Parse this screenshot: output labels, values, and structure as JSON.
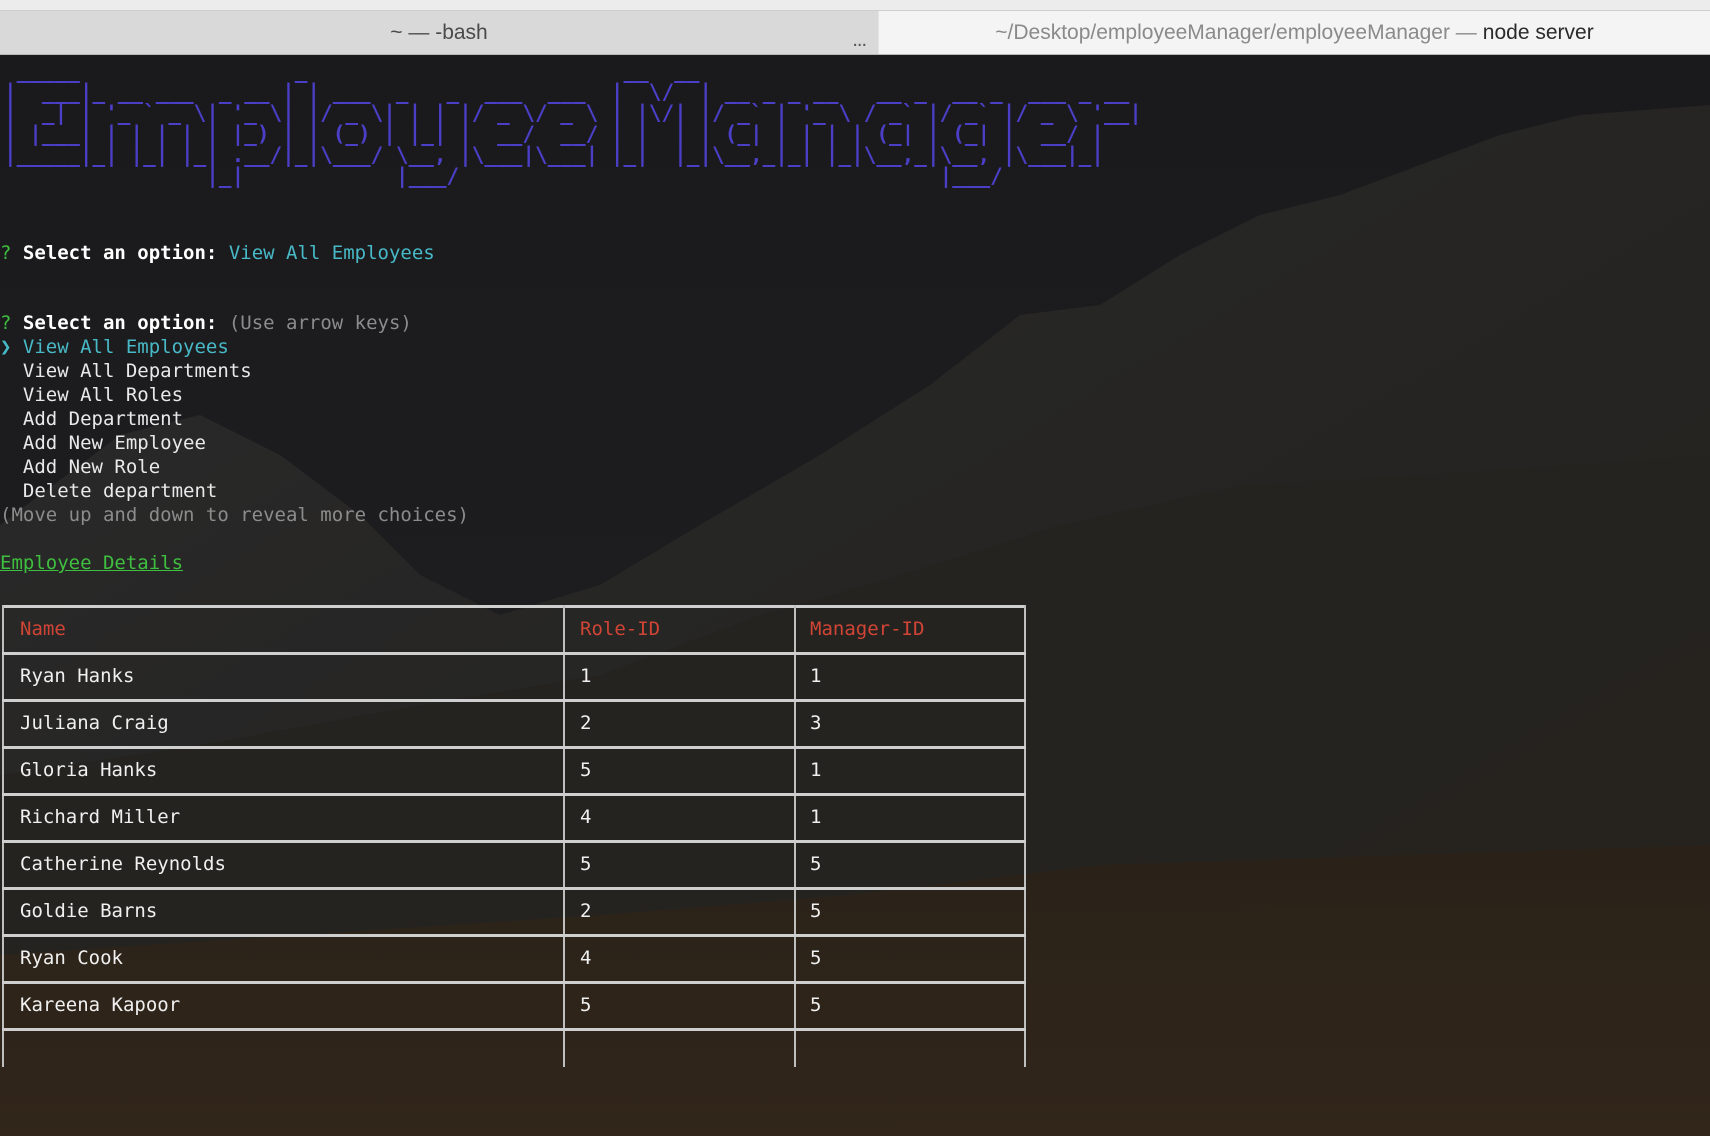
{
  "tabs": [
    {
      "label": "~ — -bash",
      "menu_glyph": "..."
    },
    {
      "label_path": "~/Desktop/employeeManager/employeeManager —",
      "label_process": "node server"
    }
  ],
  "banner": " _____                 _                         __  __\n|  ___|_ __ ___  _ __ | | ___  _   _  ___  ___  |  \\/  | __ _ _ __   __ _  __ _  ___ _ __\n|  _| | '_ ` _ \\| '_ \\| |/ _ \\| | | |/ _ \\/ _ \\ | |\\/| |/ _` | '_ \\ / _` |/ _` |/ _ \\ '__|\n| |___| | | | | | |_) | | (_) | |_| |  __/  __/ | |  | | (_| | | | | (_| | (_| |  __/ |\n|_____|_| |_| |_| .__/|_|\\___/ \\__, |\\___|\\___| |_|  |_|\\__,_|_| |_|\\__,_|\\__, |\\___|_|\n                |_|            |___/                                      |___/",
  "prompt1": {
    "mark": "?",
    "label": "Select an option:",
    "answer": "View All Employees"
  },
  "prompt2": {
    "mark": "?",
    "label": "Select an option:",
    "hint": "(Use arrow keys)"
  },
  "menu": {
    "pointer": "❯",
    "items": [
      "View All Employees",
      "View All Departments",
      "View All Roles",
      "Add Department",
      "Add New Employee",
      "Add New Role",
      "Delete department"
    ],
    "footer": "(Move up and down to reveal more choices)"
  },
  "section_title": "Employee Details",
  "table": {
    "headers": [
      "Name",
      "Role-ID",
      "Manager-ID"
    ],
    "rows": [
      [
        "Ryan Hanks",
        "1",
        "1"
      ],
      [
        "Juliana Craig",
        "2",
        "3"
      ],
      [
        "Gloria Hanks",
        "5",
        "1"
      ],
      [
        "Richard Miller",
        "4",
        "1"
      ],
      [
        "Catherine Reynolds",
        "5",
        "5"
      ],
      [
        "Goldie Barns",
        "2",
        "5"
      ],
      [
        "Ryan Cook",
        "4",
        "5"
      ],
      [
        "Kareena Kapoor",
        "5",
        "5"
      ]
    ]
  },
  "colors": {
    "banner": "#4b3fc7",
    "prompt_mark": "#3fbf3f",
    "selected": "#48b9c7",
    "header": "#d04535"
  }
}
